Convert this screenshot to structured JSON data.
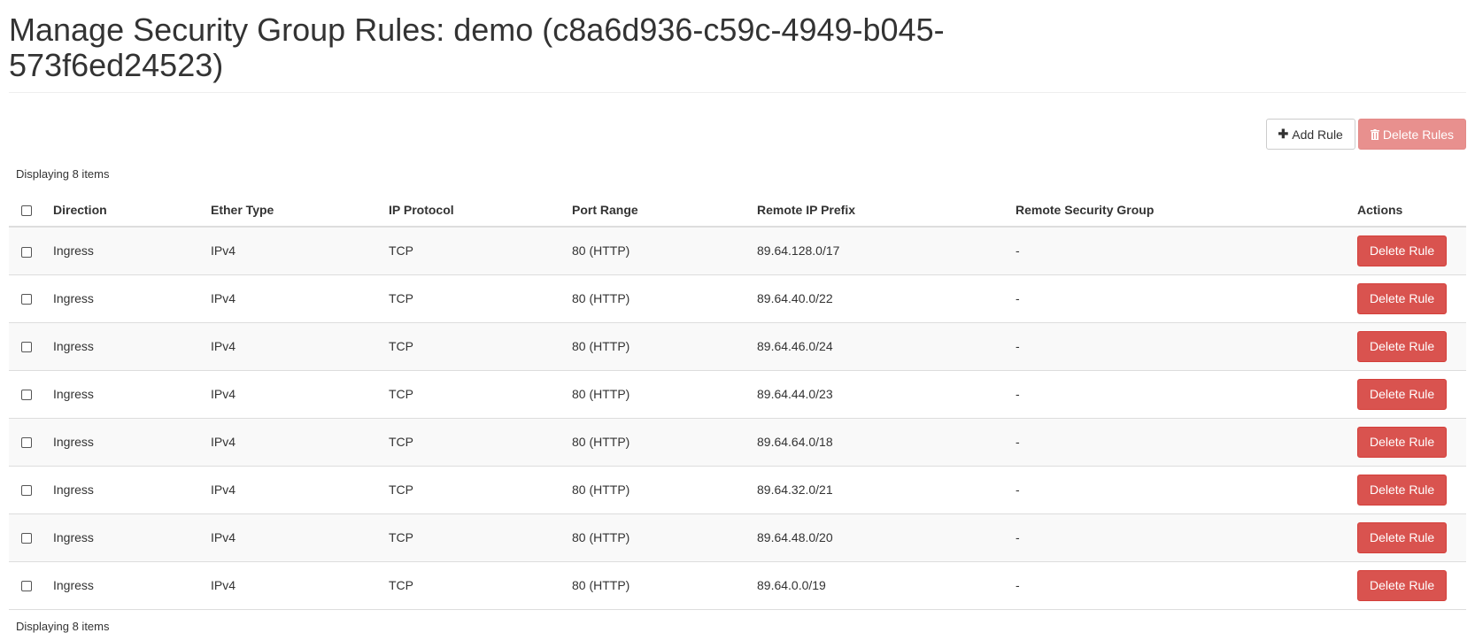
{
  "page": {
    "title": "Manage Security Group Rules: demo (c8a6d936-c59c-4949-b045-573f6ed24523)"
  },
  "toolbar": {
    "add_rule_label": "Add Rule",
    "delete_rules_label": "Delete Rules"
  },
  "table": {
    "count_top": "Displaying 8 items",
    "count_bottom": "Displaying 8 items",
    "headers": {
      "direction": "Direction",
      "ether_type": "Ether Type",
      "ip_protocol": "IP Protocol",
      "port_range": "Port Range",
      "remote_ip_prefix": "Remote IP Prefix",
      "remote_security_group": "Remote Security Group",
      "actions": "Actions"
    },
    "rows": [
      {
        "direction": "Ingress",
        "ether_type": "IPv4",
        "ip_protocol": "TCP",
        "port_range": "80 (HTTP)",
        "remote_ip_prefix": "89.64.128.0/17",
        "remote_security_group": "-",
        "action_label": "Delete Rule"
      },
      {
        "direction": "Ingress",
        "ether_type": "IPv4",
        "ip_protocol": "TCP",
        "port_range": "80 (HTTP)",
        "remote_ip_prefix": "89.64.40.0/22",
        "remote_security_group": "-",
        "action_label": "Delete Rule"
      },
      {
        "direction": "Ingress",
        "ether_type": "IPv4",
        "ip_protocol": "TCP",
        "port_range": "80 (HTTP)",
        "remote_ip_prefix": "89.64.46.0/24",
        "remote_security_group": "-",
        "action_label": "Delete Rule"
      },
      {
        "direction": "Ingress",
        "ether_type": "IPv4",
        "ip_protocol": "TCP",
        "port_range": "80 (HTTP)",
        "remote_ip_prefix": "89.64.44.0/23",
        "remote_security_group": "-",
        "action_label": "Delete Rule"
      },
      {
        "direction": "Ingress",
        "ether_type": "IPv4",
        "ip_protocol": "TCP",
        "port_range": "80 (HTTP)",
        "remote_ip_prefix": "89.64.64.0/18",
        "remote_security_group": "-",
        "action_label": "Delete Rule"
      },
      {
        "direction": "Ingress",
        "ether_type": "IPv4",
        "ip_protocol": "TCP",
        "port_range": "80 (HTTP)",
        "remote_ip_prefix": "89.64.32.0/21",
        "remote_security_group": "-",
        "action_label": "Delete Rule"
      },
      {
        "direction": "Ingress",
        "ether_type": "IPv4",
        "ip_protocol": "TCP",
        "port_range": "80 (HTTP)",
        "remote_ip_prefix": "89.64.48.0/20",
        "remote_security_group": "-",
        "action_label": "Delete Rule"
      },
      {
        "direction": "Ingress",
        "ether_type": "IPv4",
        "ip_protocol": "TCP",
        "port_range": "80 (HTTP)",
        "remote_ip_prefix": "89.64.0.0/19",
        "remote_security_group": "-",
        "action_label": "Delete Rule"
      }
    ]
  },
  "colors": {
    "danger": "#d9534f",
    "danger_disabled": "#e8908e",
    "row_stripe": "#f9f9f9",
    "border": "#dddddd"
  },
  "icons": {
    "add": "plus-icon",
    "delete": "trash-icon"
  }
}
